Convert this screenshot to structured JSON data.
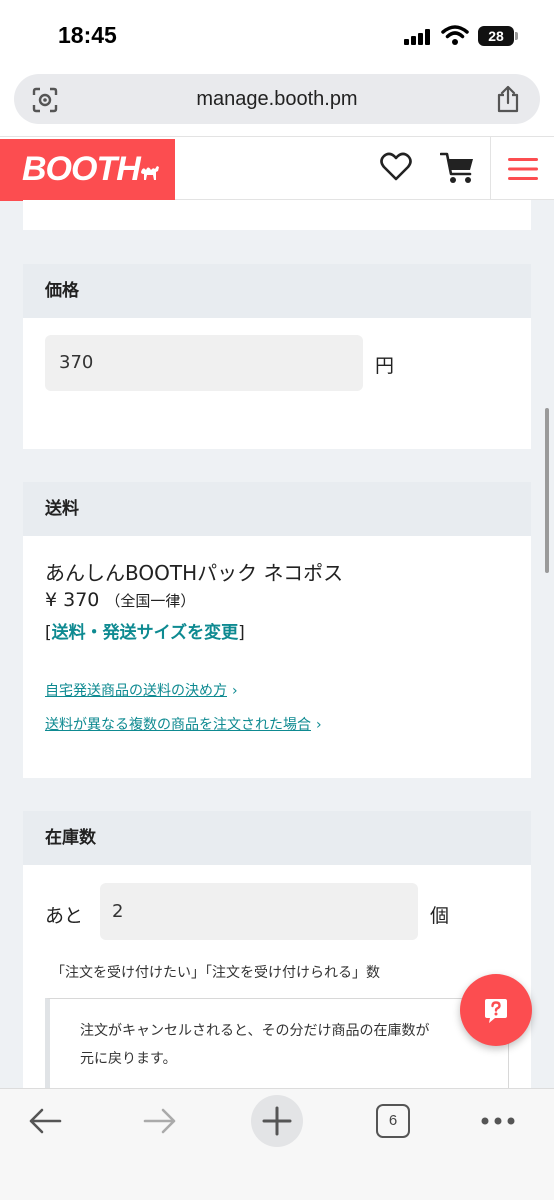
{
  "status_bar": {
    "time": "18:45",
    "battery": "28"
  },
  "browser": {
    "url": "manage.booth.pm",
    "open_tabs": "6"
  },
  "header": {
    "logo": "BOOTH"
  },
  "price_section": {
    "title": "価格",
    "value": "370",
    "unit": "円"
  },
  "shipping_section": {
    "title": "送料",
    "method": "あんしんBOOTHパック ネコポス",
    "price": "¥ 370",
    "price_note": "（全国一律）",
    "change_open": "[",
    "change_link": "送料・発送サイズを変更",
    "change_close": "]",
    "help_link_1": "自宅発送商品の送料の決め方",
    "help_link_2": "送料が異なる複数の商品を注文された場合"
  },
  "stock_section": {
    "title": "在庫数",
    "prefix": "あと",
    "value": "2",
    "unit": "個",
    "label": "「注文を受け付けたい」「注文を受け付けられる」数",
    "note_line_1": "注文がキャンセルされると、その分だけ商品の在庫数が",
    "note_line_2": "元に戻ります。"
  },
  "colors": {
    "brand": "#fc4d50",
    "link": "#0e8a91",
    "section_header_bg": "#e8ecf0"
  },
  "icons": [
    "lens-icon",
    "share-icon",
    "camel-icon",
    "heart-icon",
    "cart-icon",
    "menu-icon",
    "help-icon",
    "back-icon",
    "forward-icon",
    "plus-icon",
    "more-icon"
  ]
}
